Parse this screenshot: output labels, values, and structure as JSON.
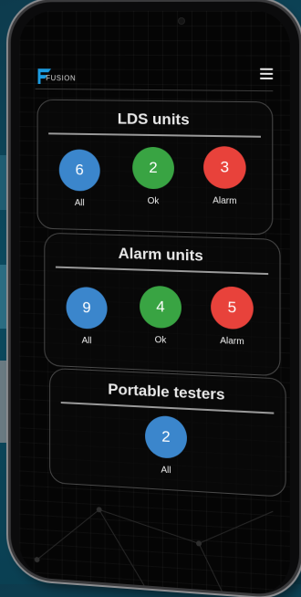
{
  "app": {
    "logo_text": "FUSION"
  },
  "colors": {
    "blue": "#3b86cc",
    "green": "#39a443",
    "red": "#e8423b"
  },
  "cards": [
    {
      "title": "LDS units",
      "stats": [
        {
          "value": "6",
          "label": "All",
          "color": "blue"
        },
        {
          "value": "2",
          "label": "Ok",
          "color": "green"
        },
        {
          "value": "3",
          "label": "Alarm",
          "color": "red"
        }
      ]
    },
    {
      "title": "Alarm units",
      "stats": [
        {
          "value": "9",
          "label": "All",
          "color": "blue"
        },
        {
          "value": "4",
          "label": "Ok",
          "color": "green"
        },
        {
          "value": "5",
          "label": "Alarm",
          "color": "red"
        }
      ]
    },
    {
      "title": "Portable testers",
      "stats": [
        {
          "value": "2",
          "label": "All",
          "color": "blue"
        }
      ]
    }
  ]
}
